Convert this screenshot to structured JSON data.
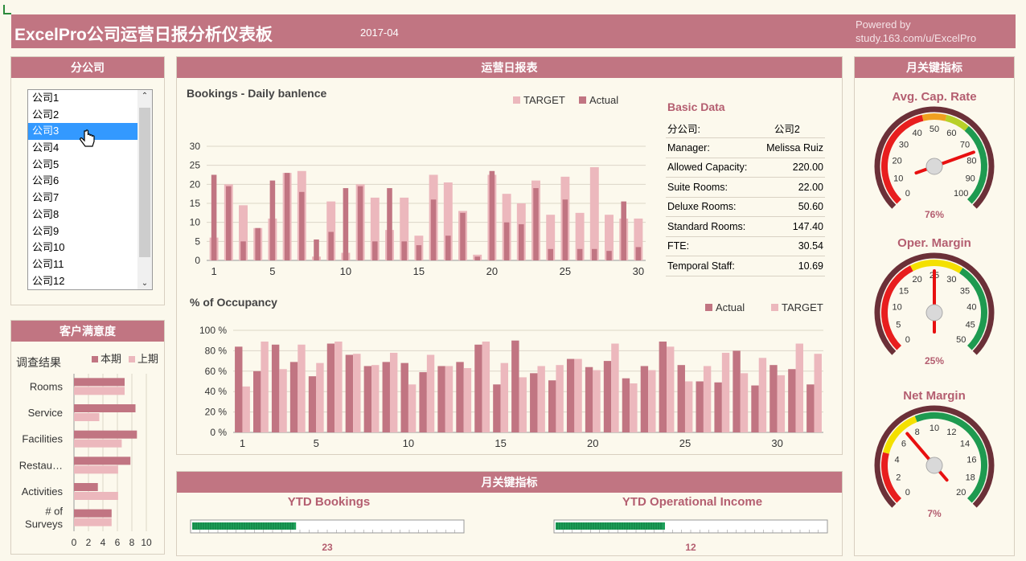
{
  "header": {
    "title": "ExcelPro公司运营日报分析仪表板",
    "month": "2017-04",
    "powered_line1": "Powered by",
    "powered_line2": "study.163.com/u/ExcelPro"
  },
  "branch_panel": {
    "title": "分公司",
    "items": [
      "公司1",
      "公司2",
      "公司3",
      "公司4",
      "公司5",
      "公司6",
      "公司7",
      "公司8",
      "公司9",
      "公司10",
      "公司11",
      "公司12"
    ],
    "selected_index": 2
  },
  "satisfaction_panel": {
    "title": "客户满意度",
    "subtitle": "调查结果"
  },
  "daily_panel": {
    "title": "运营日报表"
  },
  "basic_data": {
    "title": "Basic Data",
    "rows": [
      {
        "label": "分公司:",
        "value": "公司2"
      },
      {
        "label": "Manager:",
        "value": "Melissa Ruiz"
      },
      {
        "label": "Allowed Capacity:",
        "value": "220.00"
      },
      {
        "label": "Suite Rooms:",
        "value": "22.00"
      },
      {
        "label": "Deluxe Rooms:",
        "value": "50.60"
      },
      {
        "label": "Standard Rooms:",
        "value": "147.40"
      },
      {
        "label": "FTE:",
        "value": "30.54"
      },
      {
        "label": "Temporal Staff:",
        "value": "10.69"
      }
    ]
  },
  "monthly_kpi_panel": {
    "title": "月关键指标"
  },
  "right_panel": {
    "title": "月关键指标"
  },
  "colors": {
    "dark": "#c17582",
    "light": "#ecb8bd",
    "header": "#c17582",
    "kpi_text": "#b45e70",
    "progress": "#1ea05a"
  },
  "chart_data": [
    {
      "type": "bar",
      "title": "Bookings - Daily banlence",
      "series": [
        {
          "name": "TARGET",
          "values": [
            6,
            20,
            14.5,
            8.5,
            11,
            23,
            23.5,
            1,
            15.5,
            2,
            20,
            16.5,
            8,
            16.5,
            6.5,
            22.5,
            20.5,
            13,
            1.5,
            22.5,
            17.5,
            15,
            21,
            12,
            22,
            12.5,
            24.5,
            12,
            11,
            11
          ]
        },
        {
          "name": "Actual",
          "values": [
            22.5,
            19.5,
            5,
            8.5,
            21,
            23,
            18,
            5.5,
            7.5,
            19,
            19.5,
            5,
            19,
            5,
            4,
            16,
            6.5,
            12.5,
            1,
            23.5,
            10,
            9.5,
            19,
            3,
            16,
            3,
            3,
            2.5,
            15.5,
            3.5
          ]
        }
      ],
      "x": [
        1,
        2,
        3,
        4,
        5,
        6,
        7,
        8,
        9,
        10,
        11,
        12,
        13,
        14,
        15,
        16,
        17,
        18,
        19,
        20,
        21,
        22,
        23,
        24,
        25,
        26,
        27,
        28,
        29,
        30
      ],
      "x_ticks": [
        1,
        5,
        10,
        15,
        20,
        25,
        30
      ],
      "y_ticks": [
        0,
        5,
        10,
        15,
        20,
        25,
        30
      ],
      "ylim": [
        0,
        30
      ],
      "grid": true,
      "legend": "top-right"
    },
    {
      "type": "bar",
      "title": "% of Occupancy",
      "series": [
        {
          "name": "Actual",
          "values": [
            84,
            60,
            86,
            69,
            55,
            87,
            76,
            65,
            69,
            68,
            59,
            65,
            69,
            86,
            47,
            90,
            58,
            51,
            72,
            64,
            70,
            53,
            65,
            89,
            66,
            50,
            49,
            80,
            46,
            66,
            62,
            47
          ]
        },
        {
          "name": "TARGET",
          "values": [
            45,
            89,
            62,
            86,
            68,
            89,
            77,
            66,
            78,
            47,
            76,
            65,
            63,
            89,
            68,
            54,
            65,
            66,
            72,
            61,
            87,
            48,
            61,
            84,
            50,
            65,
            78,
            58,
            73,
            56,
            87,
            77
          ]
        }
      ],
      "x_ticks": [
        1,
        5,
        10,
        15,
        20,
        25,
        30
      ],
      "y_ticks": [
        "0 %",
        "20 %",
        "40 %",
        "60 %",
        "80 %",
        "100 %"
      ],
      "ylim": [
        0,
        100
      ],
      "grid": true,
      "legend": "top-right"
    },
    {
      "type": "bar",
      "orientation": "horizontal",
      "categories": [
        "Rooms",
        "Service",
        "Facilities",
        "Restau…",
        "Activities",
        "# of\nSurveys"
      ],
      "series": [
        {
          "name": "本期",
          "values": [
            7,
            8.5,
            8.7,
            7.8,
            3.3,
            5.2
          ]
        },
        {
          "name": "上期",
          "values": [
            7,
            3.5,
            6.6,
            6.1,
            6.1,
            5.2
          ]
        }
      ],
      "x_ticks": [
        0,
        2,
        4,
        6,
        8,
        10
      ],
      "xlim": [
        0,
        10
      ],
      "grid": true,
      "legend": "top"
    },
    {
      "type": "gauge",
      "title": "Avg. Cap. Rate",
      "ticks": [
        0,
        10,
        20,
        30,
        40,
        50,
        60,
        70,
        80,
        90,
        100
      ],
      "value": 76,
      "value_label": "76%",
      "range": [
        0,
        100
      ]
    },
    {
      "type": "gauge",
      "title": "Oper. Margin",
      "ticks": [
        0,
        5,
        10,
        15,
        20,
        25,
        30,
        35,
        40,
        45,
        50
      ],
      "value": 25,
      "value_label": "25%",
      "range": [
        0,
        50
      ]
    },
    {
      "type": "gauge",
      "title": "Net Margin",
      "ticks": [
        0,
        2,
        4,
        6,
        8,
        10,
        12,
        14,
        16,
        18,
        20
      ],
      "value": 7,
      "value_label": "7%",
      "range": [
        0,
        20
      ]
    },
    {
      "type": "progress",
      "title": "YTD Bookings",
      "value": 23,
      "value_label": "23",
      "fraction": 0.38
    },
    {
      "type": "progress",
      "title": "YTD Operational Income",
      "value": 12,
      "value_label": "12",
      "fraction": 0.4
    }
  ]
}
